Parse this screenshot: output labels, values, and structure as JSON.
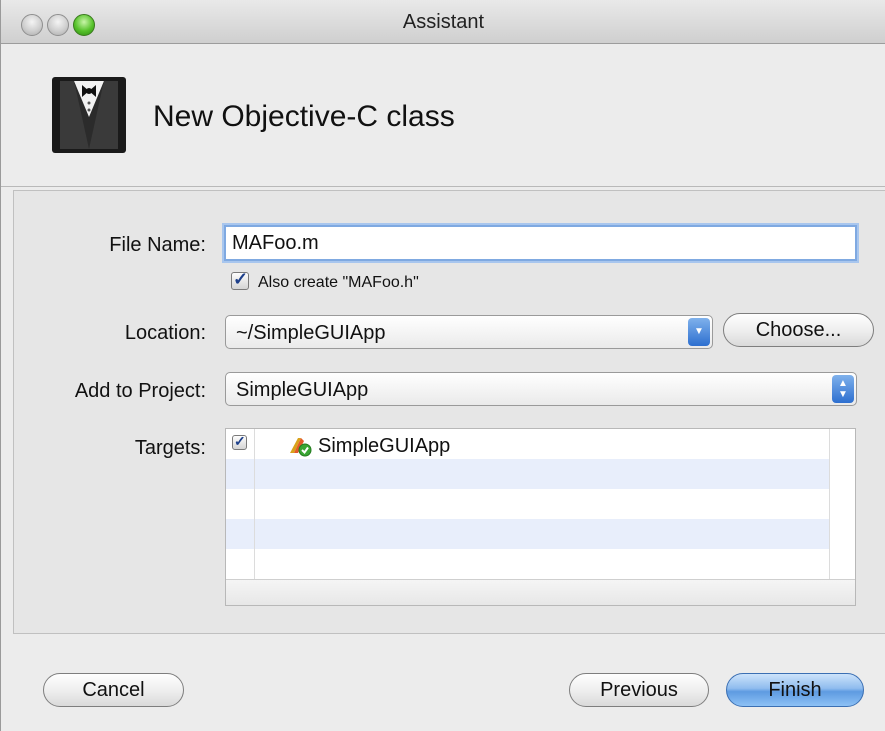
{
  "window": {
    "title": "Assistant"
  },
  "header": {
    "title": "New Objective-C class",
    "icon": "tuxedo-icon"
  },
  "form": {
    "file_name_label": "File Name:",
    "file_name_value": "MAFoo.m",
    "also_create_label": "Also create \"MAFoo.h\"",
    "also_create_checked": true,
    "location_label": "Location:",
    "location_value": "~/SimpleGUIApp",
    "choose_label": "Choose...",
    "add_to_project_label": "Add to Project:",
    "add_to_project_value": "SimpleGUIApp",
    "targets_label": "Targets:",
    "targets": [
      {
        "name": "SimpleGUIApp",
        "checked": true,
        "icon": "application-target-icon"
      }
    ]
  },
  "footer": {
    "cancel_label": "Cancel",
    "previous_label": "Previous",
    "finish_label": "Finish"
  },
  "colors": {
    "accent": "#5e9be1",
    "focus_ring": "#7fa9e1",
    "row_alt": "#e8eefb"
  }
}
